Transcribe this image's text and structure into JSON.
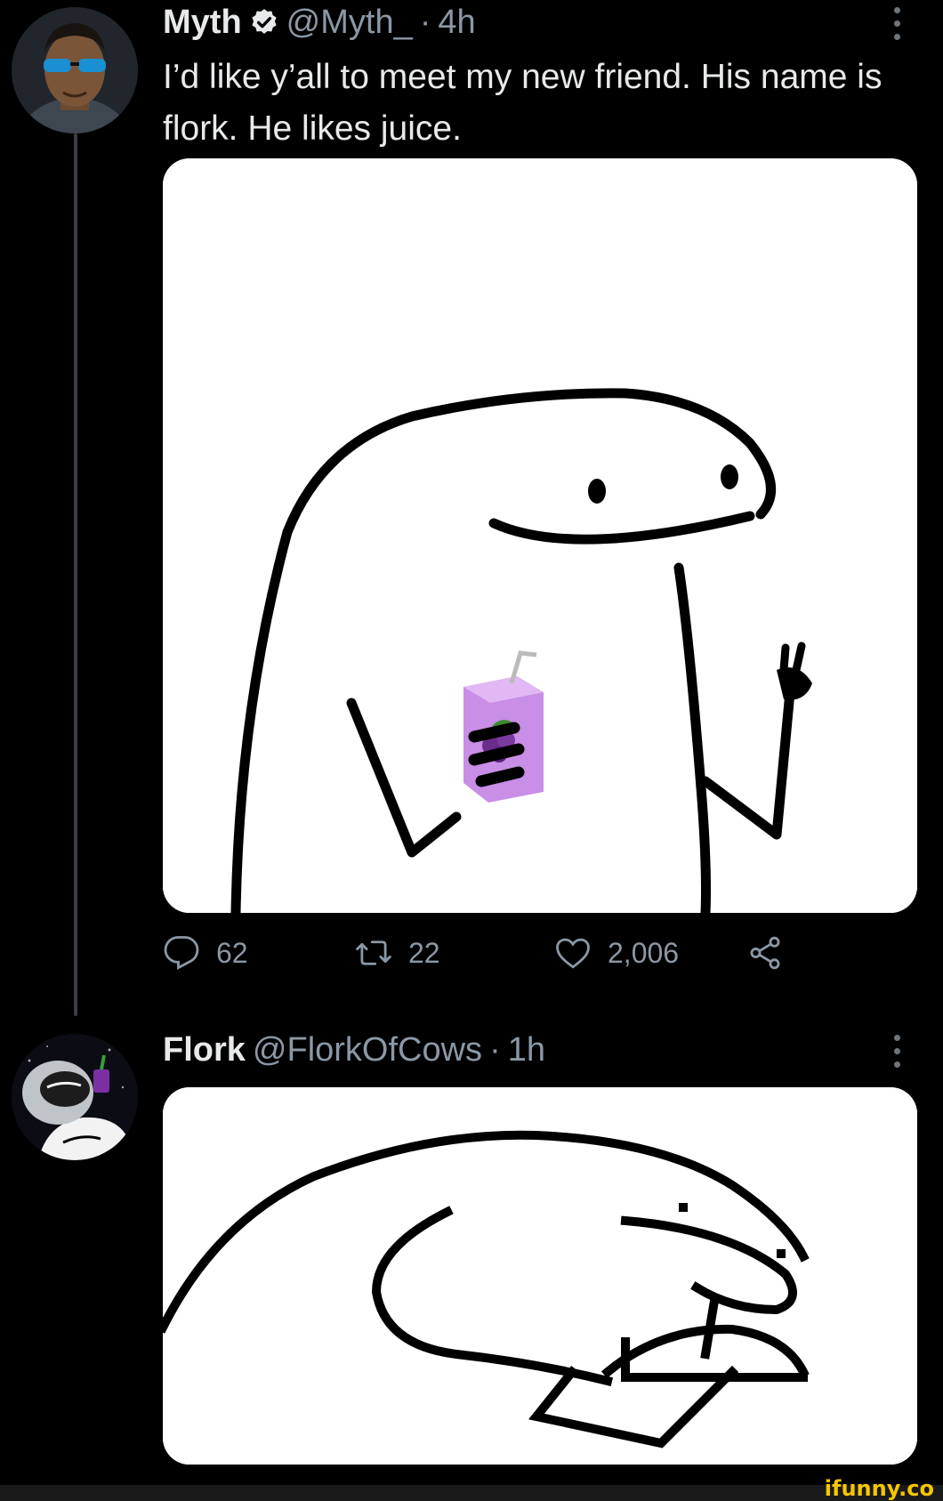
{
  "tweet1": {
    "name": "Myth",
    "handle": "@Myth_",
    "separator": "·",
    "time": "4h",
    "text": "I’d like y’all to meet my new friend. His name is flork. He likes juice.",
    "stats": {
      "replies": "62",
      "retweets": "22",
      "likes": "2,006"
    },
    "icons": [
      "verified-badge-icon",
      "more-icon",
      "reply-icon",
      "retweet-icon",
      "like-icon",
      "share-icon"
    ]
  },
  "tweet2": {
    "name": "Flork",
    "handle": "@FlorkOfCows",
    "separator": "·",
    "time": "1h",
    "icons": [
      "more-icon"
    ]
  },
  "watermark": {
    "text": "ifunny.co",
    "color": "#f6c700"
  },
  "colors": {
    "background": "#000000",
    "text": "#e7e9ea",
    "secondary": "#8b98a5",
    "thread_line": "#3a3f44"
  }
}
